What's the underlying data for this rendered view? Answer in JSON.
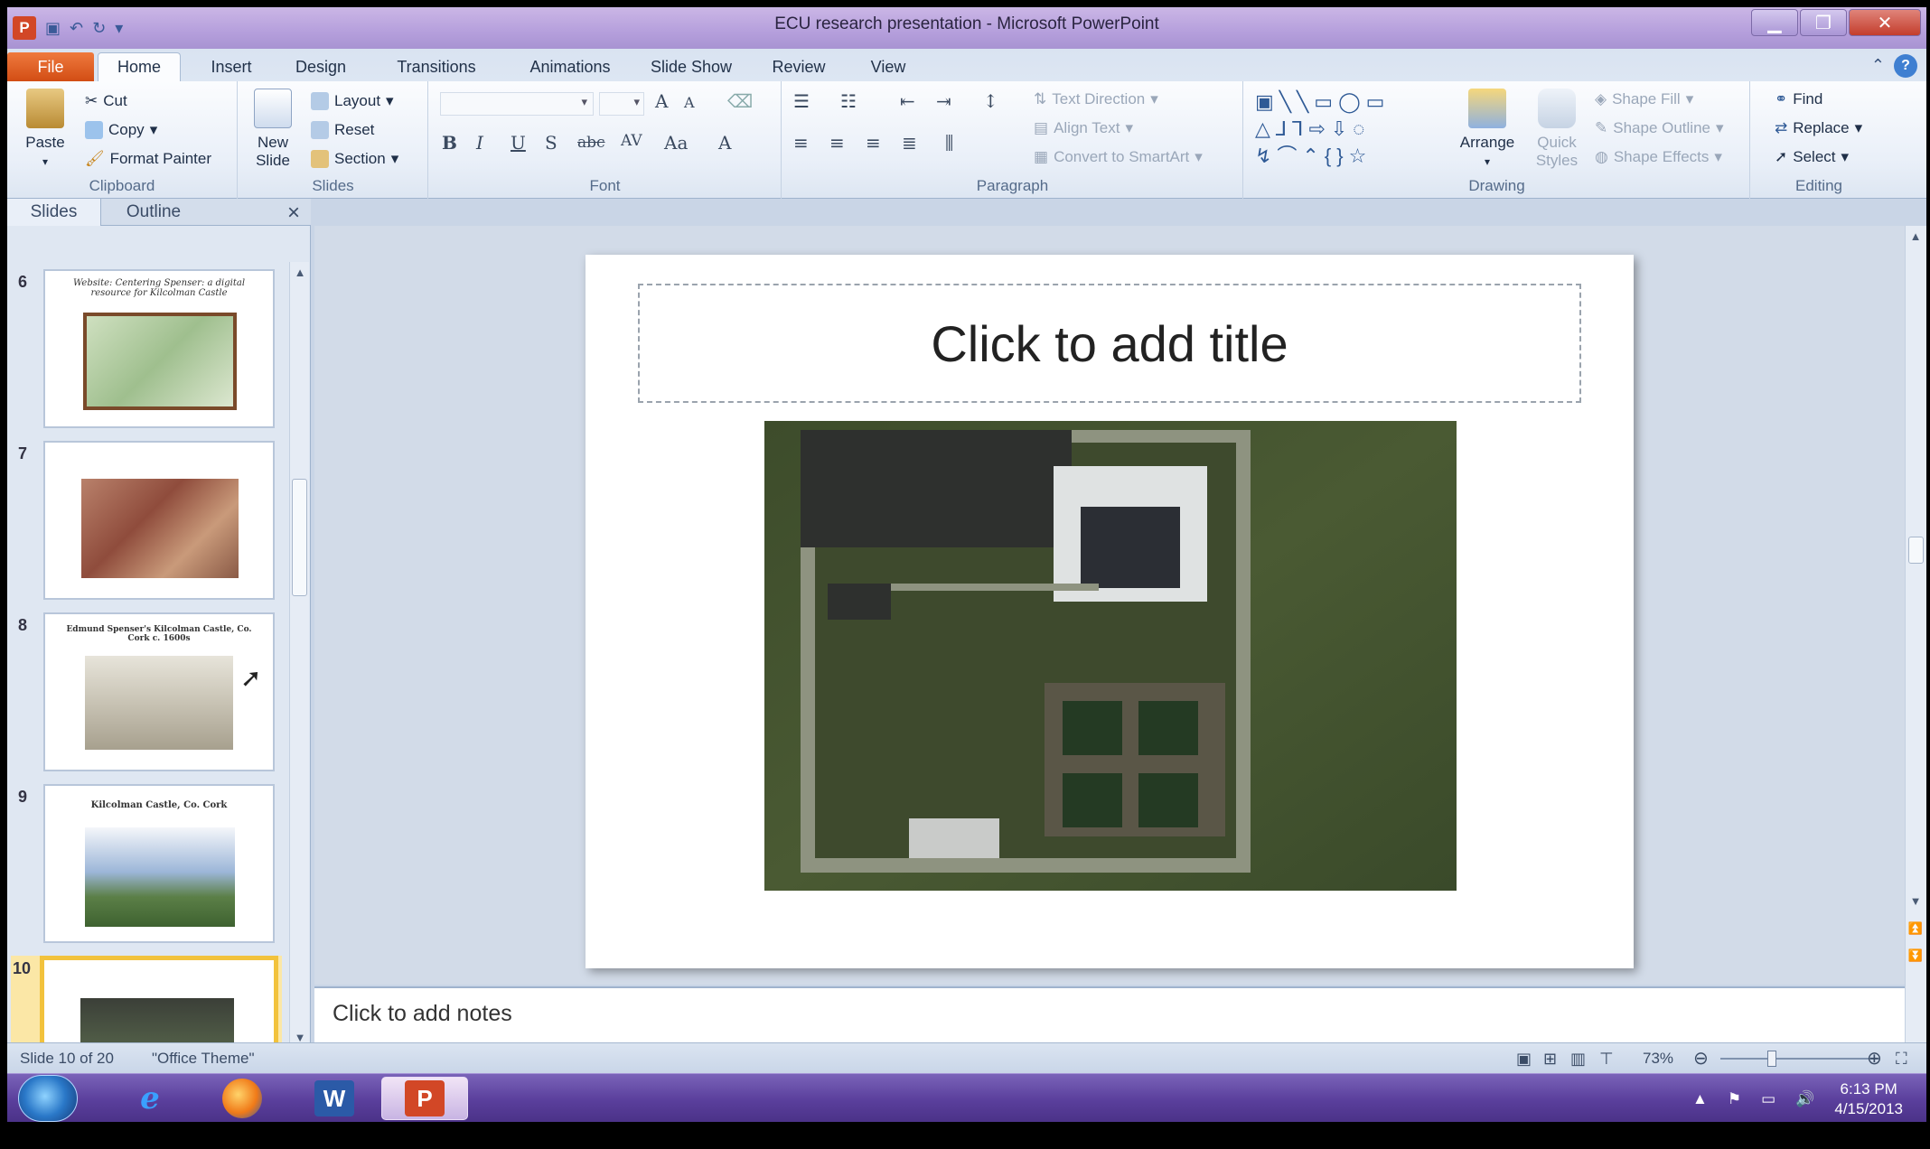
{
  "window": {
    "title": "ECU research presentation  -  Microsoft PowerPoint"
  },
  "qat": {
    "app_letter": "P"
  },
  "tabs": [
    {
      "label": "File"
    },
    {
      "label": "Home"
    },
    {
      "label": "Insert"
    },
    {
      "label": "Design"
    },
    {
      "label": "Transitions"
    },
    {
      "label": "Animations"
    },
    {
      "label": "Slide Show"
    },
    {
      "label": "Review"
    },
    {
      "label": "View"
    }
  ],
  "ribbon": {
    "clipboard": {
      "paste": "Paste",
      "cut": "Cut",
      "copy": "Copy",
      "format_painter": "Format Painter",
      "label": "Clipboard"
    },
    "slides": {
      "new_slide_1": "New",
      "new_slide_2": "Slide",
      "layout": "Layout",
      "reset": "Reset",
      "section": "Section",
      "label": "Slides"
    },
    "font": {
      "bold": "B",
      "italic": "I",
      "underline": "U",
      "shadow": "S",
      "strike": "abc",
      "spacing": "AV",
      "case": "Aa",
      "grow": "A",
      "shrink": "A",
      "color": "A",
      "label": "Font"
    },
    "paragraph": {
      "text_direction": "Text Direction",
      "align_text": "Align Text",
      "convert_smartart": "Convert to SmartArt",
      "label": "Paragraph"
    },
    "drawing": {
      "arrange": "Arrange",
      "quick_styles_1": "Quick",
      "quick_styles_2": "Styles",
      "shape_fill": "Shape Fill",
      "shape_outline": "Shape Outline",
      "shape_effects": "Shape Effects",
      "label": "Drawing"
    },
    "editing": {
      "find": "Find",
      "replace": "Replace",
      "select": "Select",
      "label": "Editing"
    }
  },
  "pane": {
    "tab_slides": "Slides",
    "tab_outline": "Outline",
    "close": "×"
  },
  "thumbnails": [
    {
      "num": "6",
      "caption": "Website: Centering Spenser: a digital resource for Kilcolman Castle"
    },
    {
      "num": "7",
      "caption": ""
    },
    {
      "num": "8",
      "caption": "Edmund Spenser's Kilcolman Castle, Co. Cork c. 1600s"
    },
    {
      "num": "9",
      "caption": "Kilcolman Castle, Co. Cork"
    },
    {
      "num": "10",
      "caption": ""
    }
  ],
  "slide": {
    "title_placeholder": "Click to add title"
  },
  "notes": {
    "placeholder": "Click to add notes"
  },
  "status": {
    "slide_info": "Slide 10 of 20",
    "theme": "\"Office Theme\"",
    "zoom": "73%"
  },
  "taskbar": {
    "time": "6:13 PM",
    "date": "4/15/2013",
    "word_letter": "W",
    "ppt_letter": "P"
  },
  "colors": {
    "file_tab": "#d24d14",
    "selected_thumb": "#f2c23c",
    "taskbar": "#5a3f9c"
  }
}
